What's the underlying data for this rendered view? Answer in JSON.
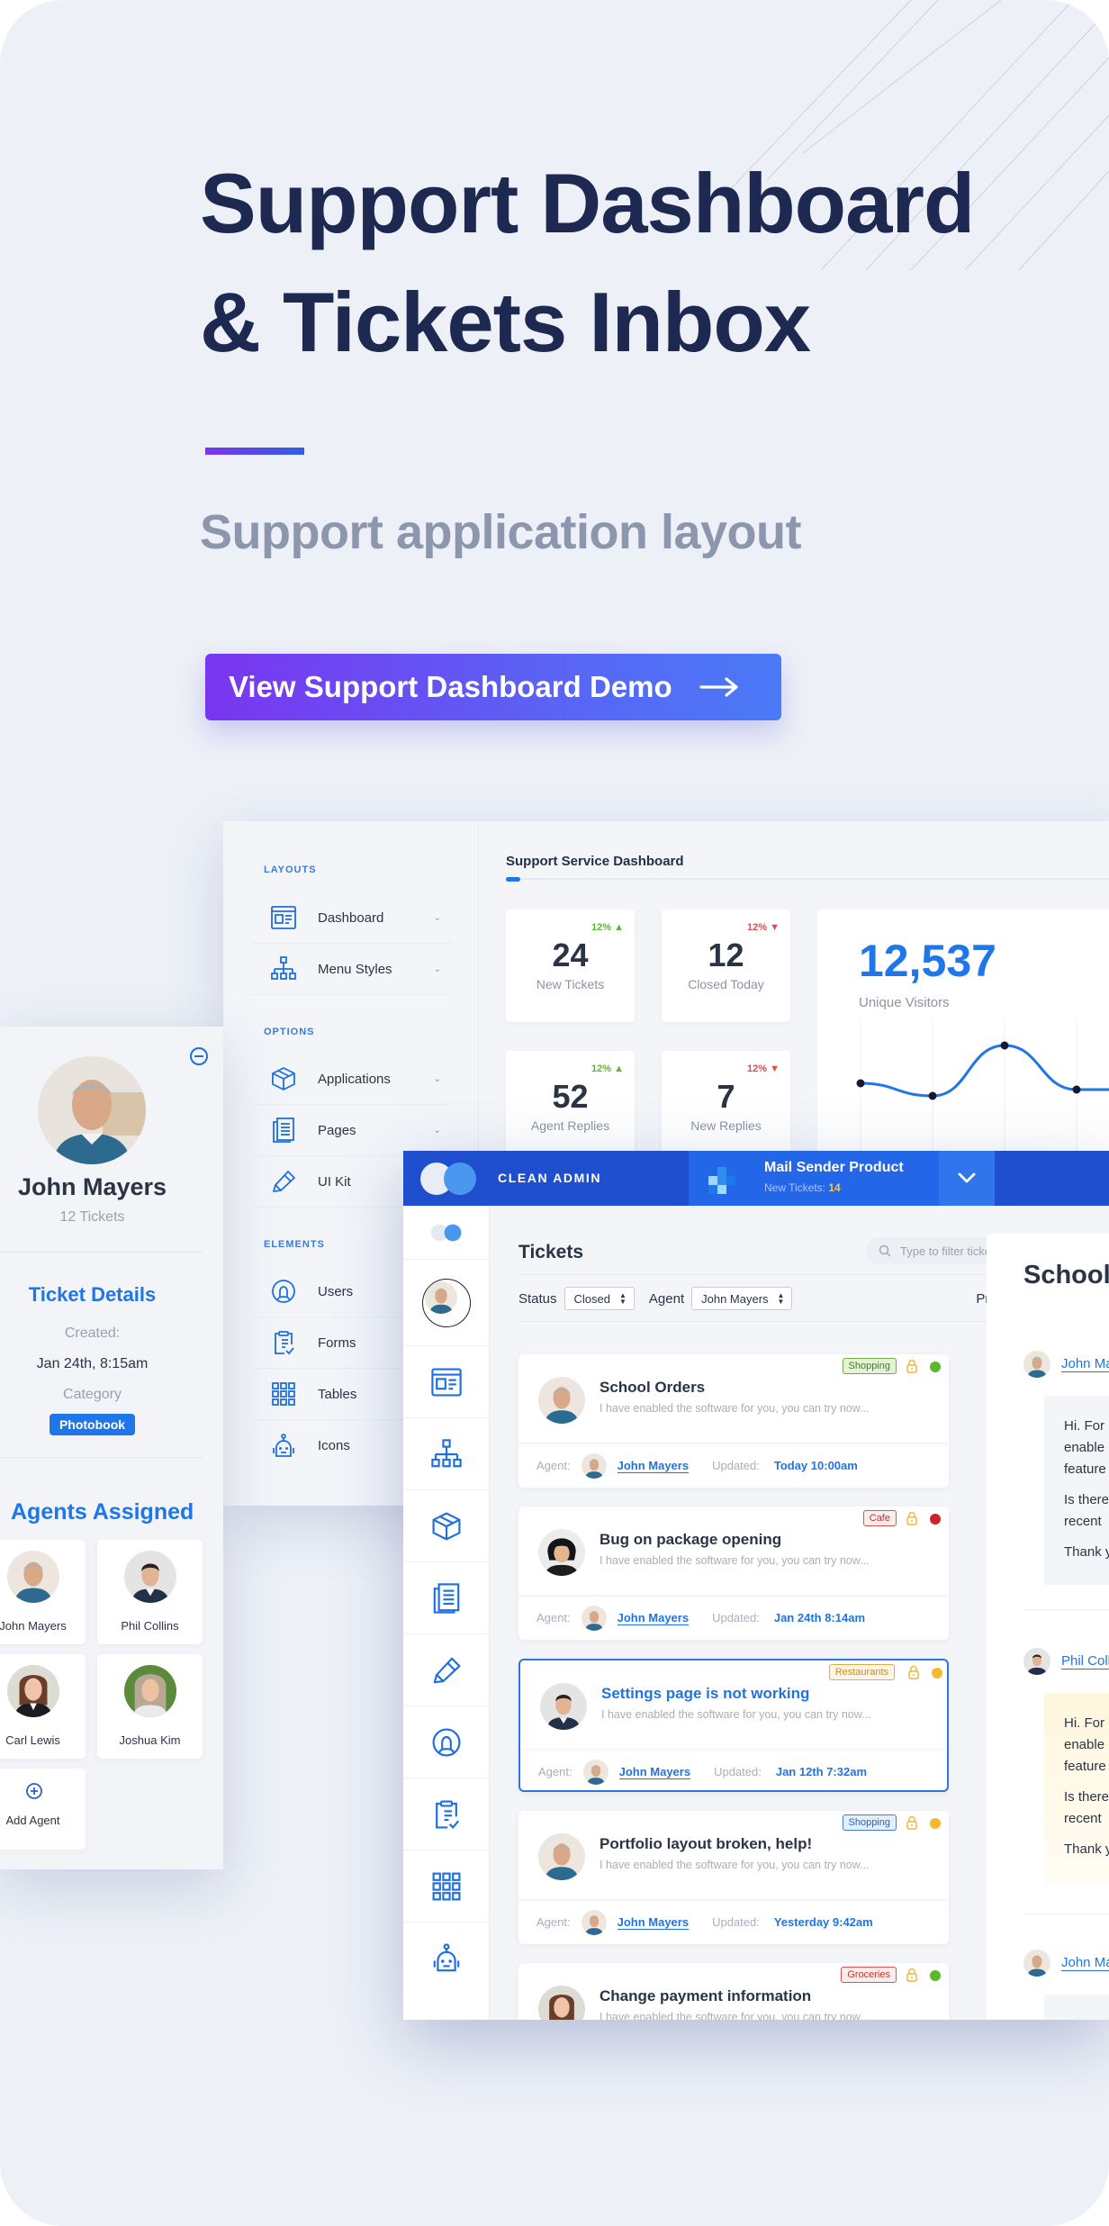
{
  "hero": {
    "title_line1": "Support Dashboard",
    "title_line2": "& Tickets Inbox",
    "subtitle": "Support application layout",
    "cta_label": "View Support Dashboard Demo",
    "cta_icon": "arrow-right-icon",
    "accent_gradient": [
      "#7a35f0",
      "#4a7af7"
    ]
  },
  "dashboard": {
    "title": "Support Service Dashboard",
    "sidebar": {
      "sections": [
        {
          "label": "LAYOUTS",
          "items": [
            {
              "label": "Dashboard",
              "icon": "browser-window-icon",
              "has_chevron": true
            },
            {
              "label": "Menu Styles",
              "icon": "sitemap-icon",
              "has_chevron": true
            }
          ]
        },
        {
          "label": "OPTIONS",
          "items": [
            {
              "label": "Applications",
              "icon": "box-icon",
              "has_chevron": true
            },
            {
              "label": "Pages",
              "icon": "document-icon",
              "has_chevron": true
            },
            {
              "label": "UI Kit",
              "icon": "pencil-icon",
              "has_chevron": false
            }
          ]
        },
        {
          "label": "ELEMENTS",
          "items": [
            {
              "label": "Users",
              "icon": "user-circle-icon",
              "has_chevron": false
            },
            {
              "label": "Forms",
              "icon": "clipboard-check-icon",
              "has_chevron": false
            },
            {
              "label": "Tables",
              "icon": "grid-icon",
              "has_chevron": false
            },
            {
              "label": "Icons",
              "icon": "robot-icon",
              "has_chevron": false
            }
          ]
        }
      ]
    },
    "stats": [
      {
        "value": "24",
        "label": "New Tickets",
        "change": "12%",
        "direction": "up"
      },
      {
        "value": "12",
        "label": "Closed Today",
        "change": "12%",
        "direction": "down"
      },
      {
        "value": "52",
        "label": "Agent Replies",
        "change": "12%",
        "direction": "up"
      },
      {
        "value": "7",
        "label": "New Replies",
        "change": "12%",
        "direction": "down"
      }
    ],
    "visitors": {
      "value": "12,537",
      "label": "Unique Visitors",
      "trend_points": [
        0.55,
        0.45,
        0.85,
        0.5,
        0.5
      ]
    },
    "up_color": "#5cb636",
    "down_color": "#e24a4a"
  },
  "ticket_detail": {
    "name": "John Mayers",
    "ticket_count": "12 Tickets",
    "section_title": "Ticket Details",
    "created_label": "Created:",
    "created_value": "Jan 24th, 8:15am",
    "category_label": "Category",
    "category_value": "Photobook",
    "agents_title": "Agents Assigned",
    "agents": [
      {
        "name": "John Mayers"
      },
      {
        "name": "Phil Collins"
      },
      {
        "name": "Carl Lewis"
      },
      {
        "name": "Joshua Kim"
      }
    ],
    "add_agent_label": "Add Agent"
  },
  "inbox": {
    "brand": "CLEAN ADMIN",
    "product": {
      "name": "Mail Sender Product",
      "meta_label": "New Tickets:",
      "meta_value": "14"
    },
    "list_title": "Tickets",
    "filter_placeholder": "Type to filter tickets...",
    "status_label": "Status",
    "status_value": "Closed",
    "agent_label": "Agent",
    "agent_value": "John Mayers",
    "private_label": "Private",
    "agent_prefix": "Agent:",
    "updated_prefix": "Updated:",
    "tickets": [
      {
        "title": "School Orders",
        "excerpt": "I have enabled the software for you, you can try now...",
        "tag": "Shopping",
        "tag_style": "green",
        "status": "green",
        "agent": "John Mayers",
        "updated": "Today 10:00am",
        "selected": false
      },
      {
        "title": "Bug on package opening",
        "excerpt": "I have enabled the software for you, you can try now...",
        "tag": "Cafe",
        "tag_style": "red",
        "status": "red",
        "agent": "John Mayers",
        "updated": "Jan 24th 8:14am",
        "selected": false
      },
      {
        "title": "Settings page is not working",
        "excerpt": "I have enabled the software for you, you can try now...",
        "tag": "Restaurants",
        "tag_style": "orange",
        "status": "yellow",
        "agent": "John Mayers",
        "updated": "Jan 12th 7:32am",
        "selected": true
      },
      {
        "title": "Portfolio layout broken, help!",
        "excerpt": "I have enabled the software for you, you can try now...",
        "tag": "Shopping",
        "tag_style": "blue",
        "status": "yellow",
        "agent": "John Mayers",
        "updated": "Yesterday 9:42am",
        "selected": false
      },
      {
        "title": "Change payment information",
        "excerpt": "I have enabled the software for you, you can try now...",
        "tag": "Groceries",
        "tag_style": "red",
        "status": "green",
        "agent": "",
        "updated": "",
        "selected": false
      }
    ],
    "conversation": {
      "title": "School Orders",
      "messages": [
        {
          "author": "John Mayers",
          "lines": [
            "Hi. For",
            "enable",
            "feature"
          ],
          "line2": [
            "Is there",
            "recent"
          ],
          "closing": "Thank you"
        },
        {
          "author": "Phil Collins",
          "lines": [
            "Hi. For",
            "enable",
            "feature"
          ],
          "line2": [
            "Is there",
            "recent"
          ],
          "closing": "Thank you"
        },
        {
          "author": "John Mayers"
        }
      ]
    },
    "rail_icons": [
      "logo-icon",
      "avatar",
      "browser-window-icon",
      "sitemap-icon",
      "box-icon",
      "document-icon",
      "pencil-icon",
      "user-circle-icon",
      "clipboard-check-icon",
      "grid-icon",
      "robot-icon"
    ]
  }
}
